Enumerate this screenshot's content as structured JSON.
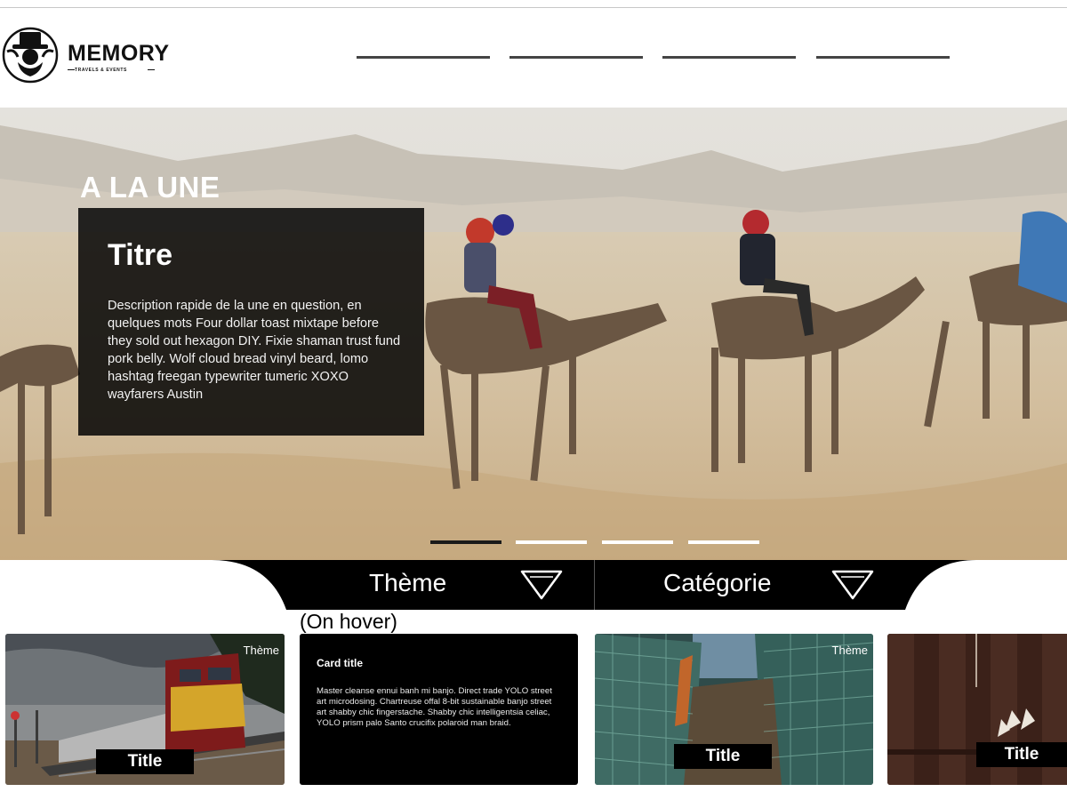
{
  "brand": {
    "name": "MEMORY",
    "tagline": "TRAVELS & EVENTS"
  },
  "nav": {
    "item_count": 4
  },
  "hero": {
    "heading": "A LA UNE",
    "featured": {
      "title": "Titre",
      "description": "Description rapide de la une en question, en quelques mots Four dollar toast mixtape before they sold out hexagon DIY. Fixie shaman trust fund pork belly. Wolf cloud bread vinyl beard, lomo hashtag freegan typewriter tumeric XOXO wayfarers Austin"
    },
    "slides": {
      "count": 4,
      "active_index": 0
    }
  },
  "filters": [
    {
      "label": "Thème",
      "icon": "funnel-icon"
    },
    {
      "label": "Catégorie",
      "icon": "funnel-icon"
    }
  ],
  "hover_note": "(On hover)",
  "cards": [
    {
      "kind": "image",
      "scene": "train",
      "theme": "Thème",
      "title": "Title"
    },
    {
      "kind": "hover",
      "title": "Card title",
      "text": "Master cleanse ennui banh mi banjo. Direct trade YOLO street art microdosing. Chartreuse offal 8-bit sustainable banjo street art shabby chic fingerstache. Shabby chic intelligentsia celiac, YOLO prism palo Santo crucifix polaroid man braid."
    },
    {
      "kind": "image",
      "scene": "fishing-nets",
      "theme": "Thème",
      "title": "Title"
    },
    {
      "kind": "image",
      "scene": "wooden-wall",
      "theme": "",
      "title": "Title"
    }
  ],
  "colors": {
    "dark": "#000000",
    "white": "#ffffff",
    "sand": "#d9c6a8",
    "nav_line": "#444444"
  }
}
